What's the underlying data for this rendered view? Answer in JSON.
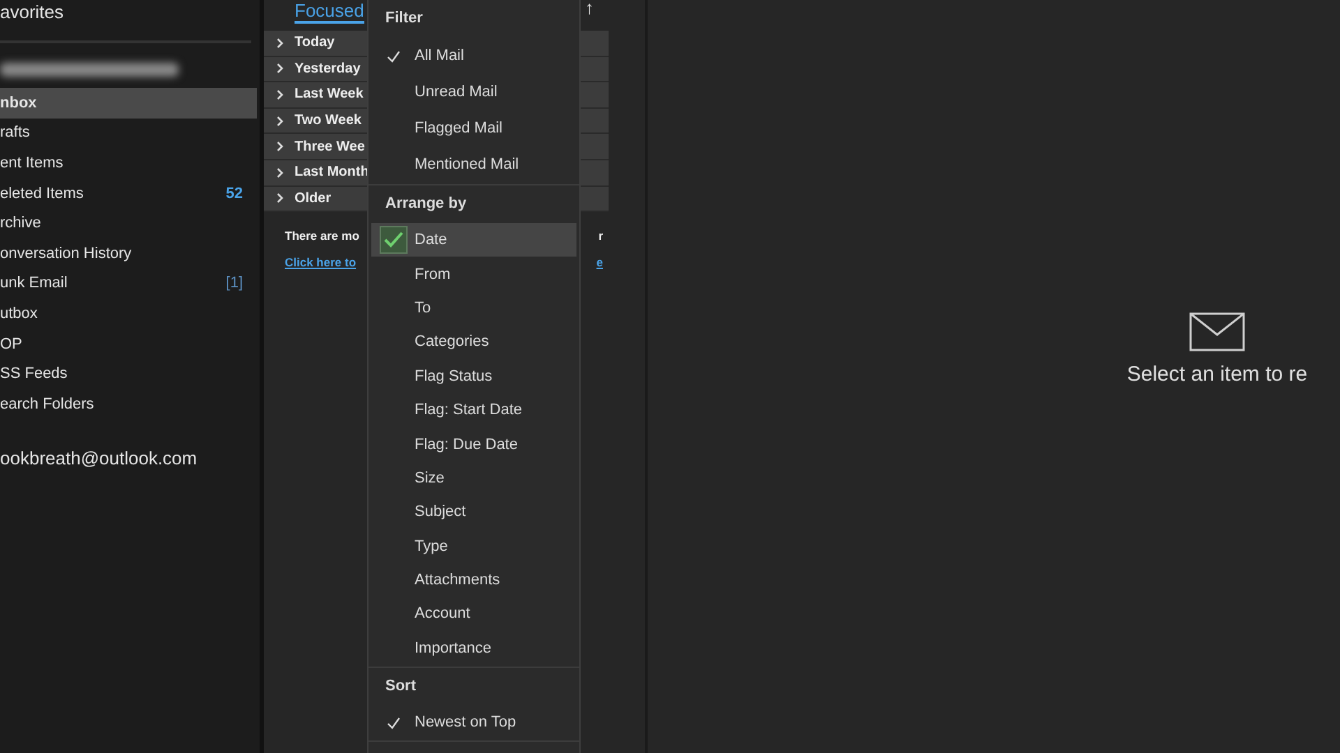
{
  "sidebar": {
    "favorites_title": "avorites",
    "folders": [
      {
        "label": "nbox",
        "selected": true
      },
      {
        "label": "rafts",
        "selected": false
      },
      {
        "label": "ent Items",
        "selected": false
      },
      {
        "label": "eleted Items",
        "selected": false,
        "count": {
          "text": "52",
          "kind": "unread"
        }
      },
      {
        "label": "rchive",
        "selected": false
      },
      {
        "label": "onversation History",
        "selected": false
      },
      {
        "label": "unk Email",
        "selected": false,
        "count": {
          "text": "[1]",
          "kind": "total"
        }
      },
      {
        "label": "utbox",
        "selected": false
      },
      {
        "label": "OP",
        "selected": false
      },
      {
        "label": "SS Feeds",
        "selected": false
      },
      {
        "label": "earch Folders",
        "selected": false
      }
    ],
    "second_account": "ookbreath@outlook.com"
  },
  "message_list": {
    "tabs": [
      {
        "label": "Focused",
        "selected": true
      }
    ],
    "sort_arrow": "↑",
    "groups": [
      {
        "label": "Today",
        "expanded": false
      },
      {
        "label": "Yesterday",
        "expanded": false
      },
      {
        "label": "Last Week",
        "expanded": false
      },
      {
        "label": "Two Week",
        "expanded": false
      },
      {
        "label": "Three Wee",
        "expanded": false
      },
      {
        "label": "Last Month",
        "expanded": false
      },
      {
        "label": "Older",
        "expanded": false
      }
    ],
    "notice": [
      "There are mo",
      "r"
    ],
    "link": [
      "Click here to",
      "e"
    ]
  },
  "menu": {
    "sections": [
      {
        "title": "Filter",
        "items": [
          {
            "label": "All Mail",
            "checked": true,
            "highlighted": false
          },
          {
            "label": "Unread Mail",
            "checked": false,
            "highlighted": false
          },
          {
            "label": "Flagged Mail",
            "checked": false,
            "highlighted": false
          },
          {
            "label": "Mentioned Mail",
            "checked": false,
            "highlighted": false
          }
        ]
      },
      {
        "title": "Arrange by",
        "items": [
          {
            "label": "Date",
            "checked": true,
            "highlighted": true
          },
          {
            "label": "From",
            "checked": false,
            "highlighted": false
          },
          {
            "label": "To",
            "checked": false,
            "highlighted": false
          },
          {
            "label": "Categories",
            "checked": false,
            "highlighted": false
          },
          {
            "label": "Flag Status",
            "checked": false,
            "highlighted": false
          },
          {
            "label": "Flag: Start Date",
            "checked": false,
            "highlighted": false
          },
          {
            "label": "Flag: Due Date",
            "checked": false,
            "highlighted": false
          },
          {
            "label": "Size",
            "checked": false,
            "highlighted": false
          },
          {
            "label": "Subject",
            "checked": false,
            "highlighted": false
          },
          {
            "label": "Type",
            "checked": false,
            "highlighted": false
          },
          {
            "label": "Attachments",
            "checked": false,
            "highlighted": false
          },
          {
            "label": "Account",
            "checked": false,
            "highlighted": false
          },
          {
            "label": "Importance",
            "checked": false,
            "highlighted": false
          }
        ]
      },
      {
        "title": "Sort",
        "items": [
          {
            "label": "Newest on Top",
            "checked": true,
            "highlighted": false
          }
        ]
      }
    ]
  },
  "reading_pane": {
    "message": "Select an item to re"
  }
}
